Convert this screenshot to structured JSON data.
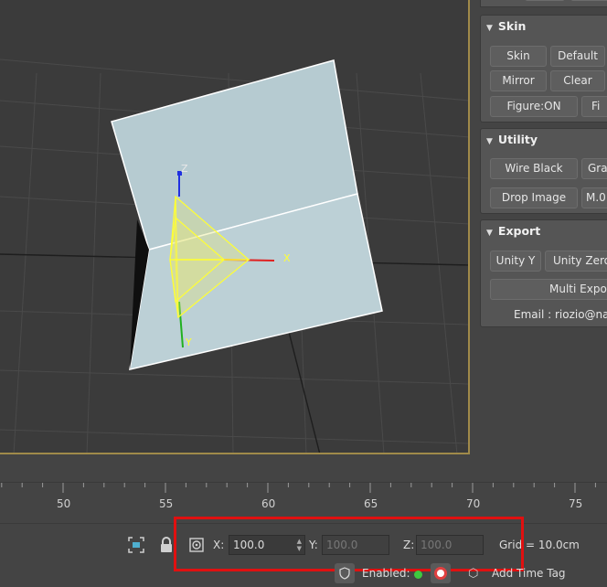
{
  "panel": {
    "skin": {
      "title": "Skin",
      "buttons": [
        "Skin",
        "Default",
        "Mirror",
        "Clear",
        "Figure:ON",
        "Fi"
      ]
    },
    "utility": {
      "title": "Utility",
      "buttons": [
        "Wire Black",
        "Gra",
        "Drop Image",
        "M.0"
      ]
    },
    "export": {
      "title": "Export",
      "buttons": [
        "Unity Y",
        "Unity Zero",
        "Multi Expor"
      ],
      "email": "Email : riozio@na"
    }
  },
  "viewport": {
    "gizmo_axes": {
      "x": "X",
      "y": "Y",
      "z": "Z"
    },
    "colors": {
      "frame": "#a08a4a",
      "plane": "#b8cdd3",
      "gizmo": "#ffff33",
      "x_axis": "#e02020",
      "y_axis": "#20b020",
      "z_axis": "#2030e0"
    }
  },
  "timeline": {
    "ticks": [
      "50",
      "55",
      "60",
      "65",
      "70",
      "75"
    ]
  },
  "status": {
    "x_label": "X:",
    "x_value": "100.0",
    "y_label": "Y:",
    "y_value": "100.0",
    "z_label": "Z:",
    "z_value": "100.0",
    "grid": "Grid = 10.0cm",
    "enabled_label": "Enabled:",
    "add_time_tag": "Add Time Tag",
    "highlight_color": "#e01010"
  }
}
